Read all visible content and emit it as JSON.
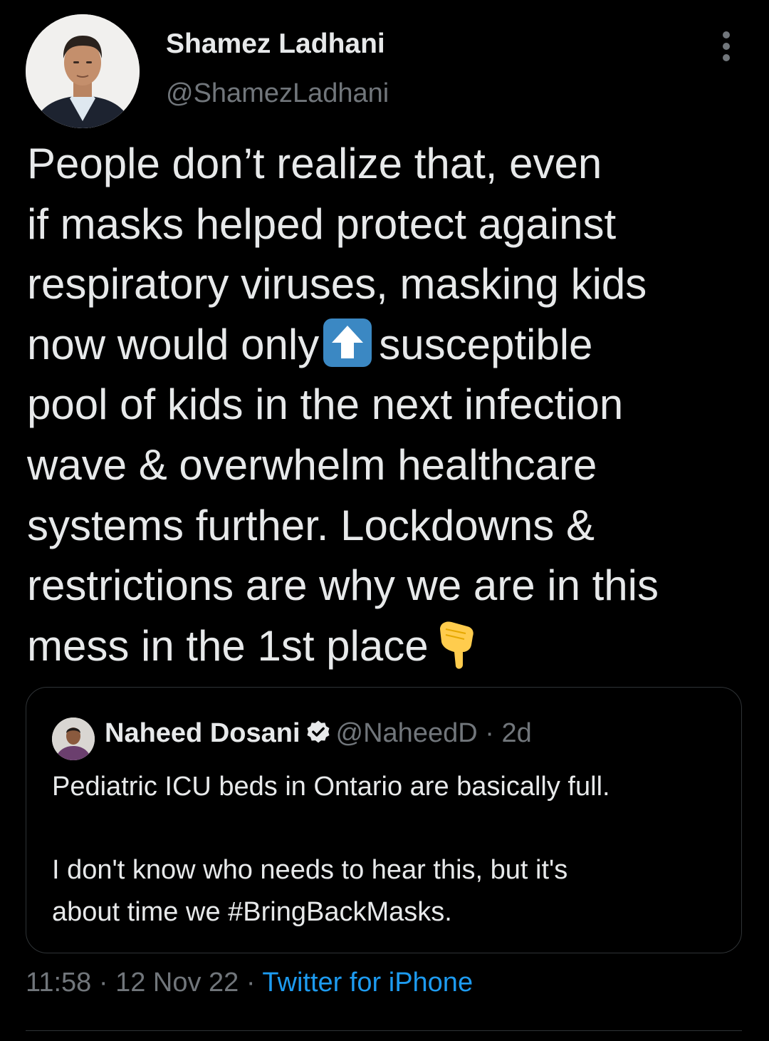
{
  "tweet": {
    "author": {
      "name": "Shamez Ladhani",
      "handle": "@ShamezLadhani"
    },
    "text_lines": [
      "People don’t realize that, even",
      "if masks helped protect against",
      "respiratory viruses, masking kids",
      "now would only",
      "susceptible",
      "pool of kids in the next infection",
      "wave & overwhelm healthcare",
      "systems further. Lockdowns &",
      "restrictions are why we are in this",
      "mess in the 1st place"
    ],
    "emoji": {
      "inline": "up-arrow-emoji",
      "trailing": "backhand-index-pointing-down-emoji"
    },
    "quoted": {
      "name": "Naheed Dosani",
      "verified": true,
      "handle": "@NaheedD",
      "separator": "·",
      "age": "2d",
      "text_lines": [
        "Pediatric ICU beds in Ontario are basically full.",
        "",
        "I don't know who needs to hear this, but it's",
        "about time we #BringBackMasks."
      ]
    },
    "meta": {
      "time": "11:58",
      "date": "12 Nov 22",
      "separator": "·",
      "source": "Twitter for iPhone"
    }
  },
  "colors": {
    "background": "#000000",
    "text": "#e7e9ea",
    "secondary": "#71767b",
    "link": "#1d9bf0",
    "border": "#2f3336",
    "verified": "#e7e9ea",
    "emoji_blue": "#3b88c3",
    "emoji_yellow": "#ffcc4d"
  }
}
